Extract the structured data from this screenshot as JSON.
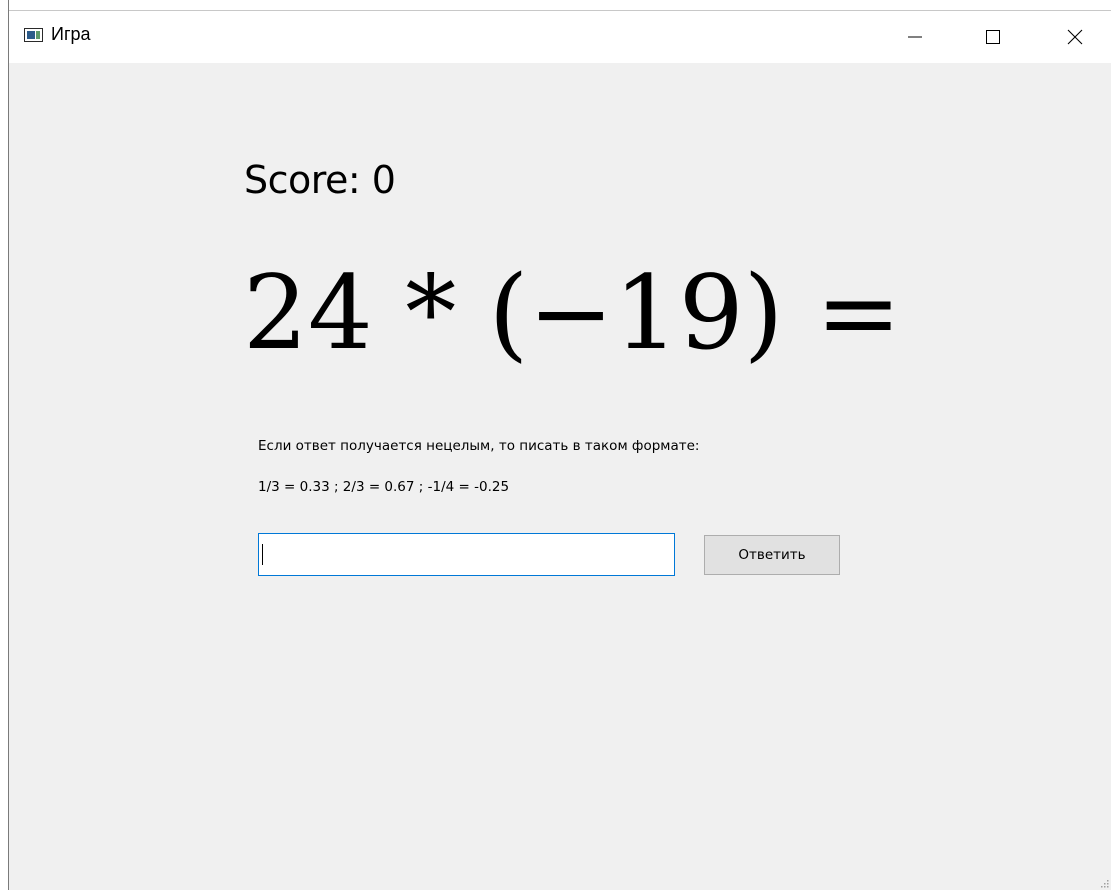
{
  "window": {
    "title": "Игра",
    "controls": {
      "minimize": "minimize",
      "maximize": "maximize",
      "close": "close"
    }
  },
  "game": {
    "score_text": "Score: 0",
    "expression": "24 * (−19) =",
    "hint_line1": "Если ответ получается нецелым, то писать в таком формате:",
    "hint_line2": "1/3 = 0.33 ; 2/3 = 0.67 ; -1/4 = -0.25",
    "answer_value": "",
    "submit_label": "Ответить"
  },
  "colors": {
    "window_bg": "#f0f0f0",
    "titlebar_bg": "#ffffff",
    "input_focus_border": "#0078d7",
    "button_bg": "#e1e1e1",
    "button_border": "#adadad"
  },
  "icons": {
    "app": "app-window-icon",
    "minimize": "minimize-icon",
    "maximize": "maximize-icon",
    "close": "close-icon",
    "resize": "resize-grip-icon"
  }
}
